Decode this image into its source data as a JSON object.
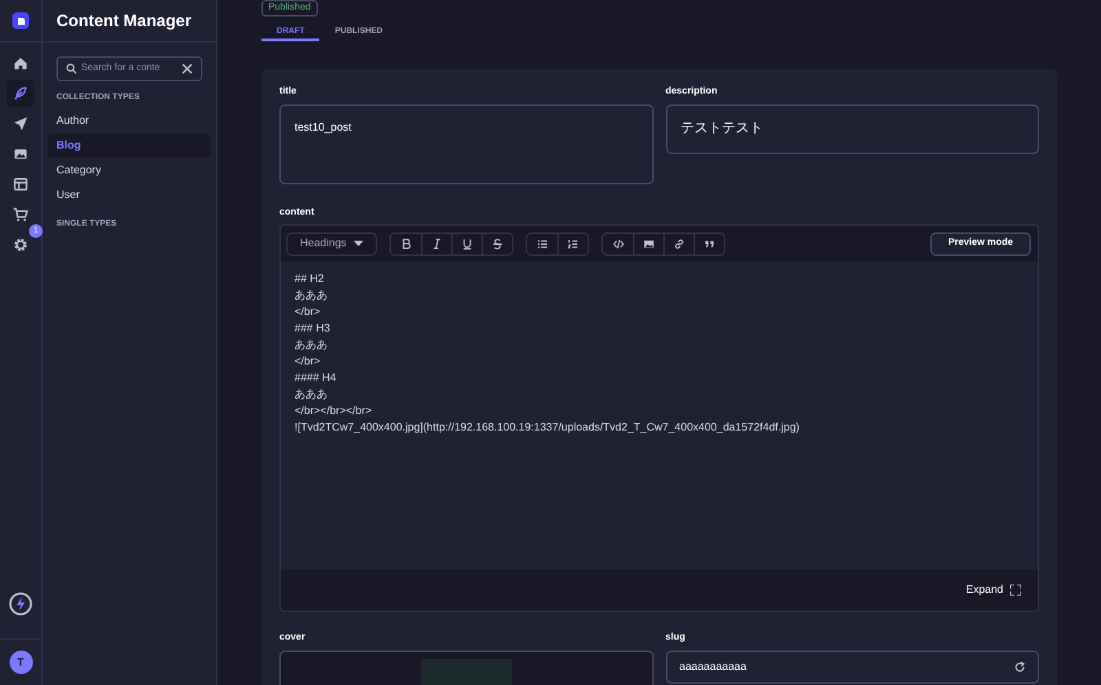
{
  "nav": [
    {
      "kind": "home",
      "selected": false
    },
    {
      "kind": "feather",
      "selected": true
    },
    {
      "kind": "plane",
      "selected": false
    },
    {
      "kind": "image",
      "selected": false
    },
    {
      "kind": "layout",
      "selected": false
    },
    {
      "kind": "cart",
      "selected": false
    },
    {
      "kind": "gear",
      "selected": false,
      "badge": "1"
    }
  ],
  "avatar": "T",
  "sidebar": {
    "title": "Content Manager",
    "search": {
      "placeholder": "Search for a conte"
    },
    "sections": [
      {
        "heading": "COLLECTION TYPES",
        "items": [
          {
            "label": "Author",
            "selected": false
          },
          {
            "label": "Blog",
            "selected": true
          },
          {
            "label": "Category",
            "selected": false
          },
          {
            "label": "User",
            "selected": false
          }
        ]
      },
      {
        "heading": "SINGLE TYPES"
      }
    ]
  },
  "status_badge": "Published",
  "tabs": [
    {
      "label": "DRAFT",
      "selected": true
    },
    {
      "label": "PUBLISHED",
      "selected": false
    }
  ],
  "fields": {
    "title": {
      "label": "title",
      "value": "test10_post"
    },
    "description": {
      "label": "description",
      "value": "テストテスト"
    },
    "content": {
      "label": "content",
      "headings": "Headings",
      "preview": "Preview mode",
      "expand": "Expand",
      "lines": [
        "## H2",
        "あああ",
        "</br>",
        "### H3",
        "あああ",
        "</br>",
        "#### H4",
        "あああ",
        "</br></br></br>",
        "![Tvd2TCw7_400x400.jpg](http://192.168.100.19:1337/uploads/Tvd2_T_Cw7_400x400_da1572f4df.jpg)"
      ]
    },
    "cover": {
      "label": "cover"
    },
    "slug": {
      "label": "slug",
      "value": "aaaaaaaaaaa"
    }
  }
}
